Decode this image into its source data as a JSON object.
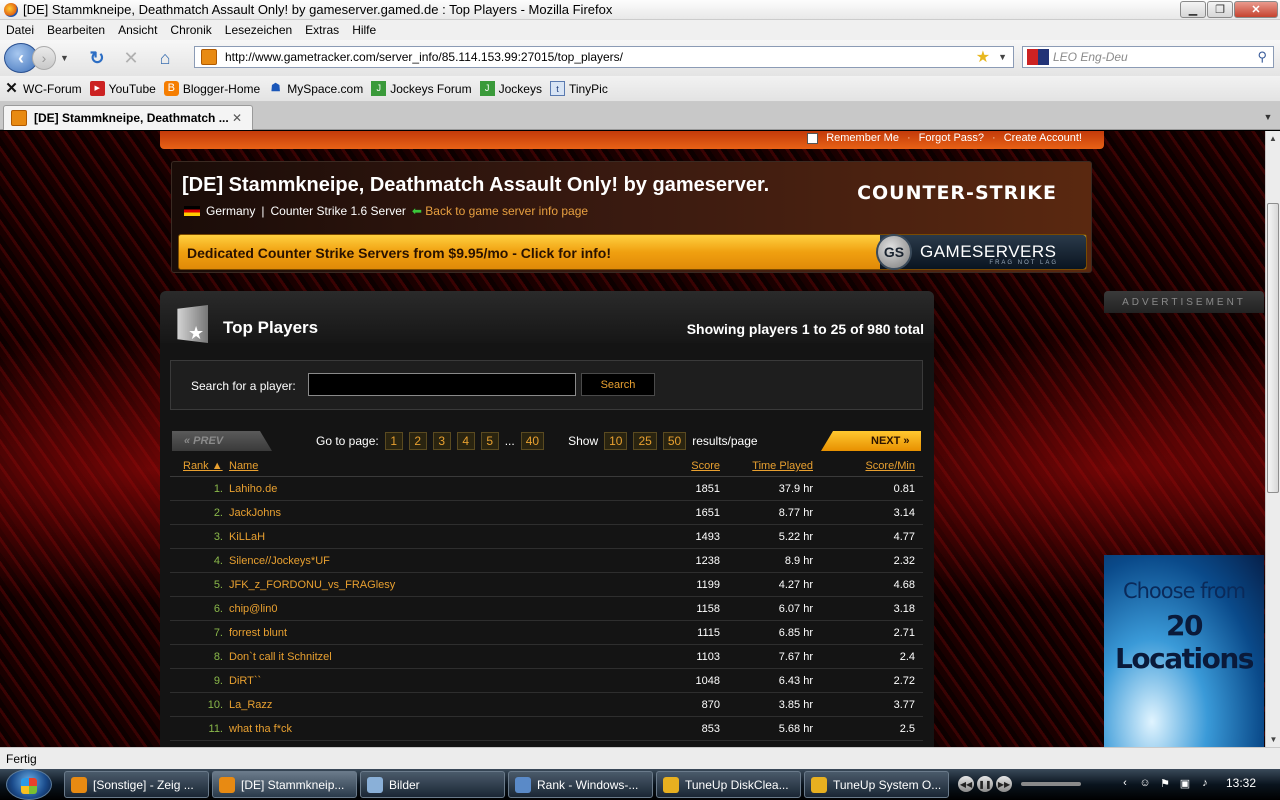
{
  "window": {
    "title": "[DE] Stammkneipe, Deathmatch Assault Only! by gameserver.gamed.de : Top Players - Mozilla Firefox",
    "min": "▁",
    "max": "❐",
    "close": "✕"
  },
  "menu": [
    "Datei",
    "Bearbeiten",
    "Ansicht",
    "Chronik",
    "Lesezeichen",
    "Extras",
    "Hilfe"
  ],
  "nav": {
    "url": "http://www.gametracker.com/server_info/85.114.153.99:27015/top_players/",
    "search_placeholder": "LEO Eng-Deu"
  },
  "bookmarks": [
    "WC-Forum",
    "YouTube",
    "Blogger-Home",
    "MySpace.com",
    "Jockeys Forum",
    "Jockeys",
    "TinyPic"
  ],
  "tab": {
    "label": "[DE] Stammkneipe, Deathmatch ..."
  },
  "site": {
    "login": {
      "remember": "Remember Me",
      "forgot": "Forgot Pass?",
      "create": "Create Account!"
    },
    "server_title": "[DE] Stammkneipe, Deathmatch Assault Only! by gameserver.",
    "country": "Germany",
    "separator": "|",
    "game": "Counter Strike 1.6 Server",
    "back_link": "Back to game server info page",
    "game_logo": "COUNTER-STRIKE",
    "banner_text": "Dedicated Counter Strike Servers from $9.95/mo - Click for info!",
    "banner_brand": "GAMESERVERS",
    "banner_brand_short": "GS",
    "banner_tagline": "FRAG NOT LAG",
    "advertisement": "ADVERTISEMENT",
    "ad_line1": "Choose from",
    "ad_line2": "20 Locations"
  },
  "top_players": {
    "title": "Top Players",
    "showing": "Showing players 1 to 25 of 980 total",
    "search_label": "Search for a player:",
    "search_value": "",
    "search_button": "Search",
    "prev": "« PREV",
    "next": "NEXT »",
    "goto_label": "Go to page:",
    "pages": [
      "1",
      "2",
      "3",
      "4",
      "5"
    ],
    "ellipsis": "...",
    "last_page": "40",
    "show_label": "Show",
    "per_page": [
      "10",
      "25",
      "50"
    ],
    "per_page_suffix": "results/page",
    "columns": {
      "rank": "Rank ▲",
      "name": "Name",
      "score": "Score",
      "time": "Time Played",
      "spm": "Score/Min"
    },
    "rows": [
      {
        "rank": "1.",
        "name": "Lahiho.de",
        "score": "1851",
        "time": "37.9 hr",
        "spm": "0.81"
      },
      {
        "rank": "2.",
        "name": "JackJohns",
        "score": "1651",
        "time": "8.77 hr",
        "spm": "3.14"
      },
      {
        "rank": "3.",
        "name": "KiLLaH",
        "score": "1493",
        "time": "5.22 hr",
        "spm": "4.77"
      },
      {
        "rank": "4.",
        "name": "Silence//Jockeys*UF",
        "score": "1238",
        "time": "8.9 hr",
        "spm": "2.32"
      },
      {
        "rank": "5.",
        "name": "JFK_z_FORDONU_vs_FRAGlesy",
        "score": "1199",
        "time": "4.27 hr",
        "spm": "4.68"
      },
      {
        "rank": "6.",
        "name": "chip@lin0",
        "score": "1158",
        "time": "6.07 hr",
        "spm": "3.18"
      },
      {
        "rank": "7.",
        "name": "forrest blunt",
        "score": "1115",
        "time": "6.85 hr",
        "spm": "2.71"
      },
      {
        "rank": "8.",
        "name": "Don`t call it Schnitzel",
        "score": "1103",
        "time": "7.67 hr",
        "spm": "2.4"
      },
      {
        "rank": "9.",
        "name": "DiRT``",
        "score": "1048",
        "time": "6.43 hr",
        "spm": "2.72"
      },
      {
        "rank": "10.",
        "name": "La_Razz",
        "score": "870",
        "time": "3.85 hr",
        "spm": "3.77"
      },
      {
        "rank": "11.",
        "name": "what tha f*ck",
        "score": "853",
        "time": "5.68 hr",
        "spm": "2.5"
      }
    ]
  },
  "status": "Fertig",
  "taskbar": {
    "items": [
      {
        "label": "[Sonstige] - Zeig ...",
        "icon_color": "#e88a12"
      },
      {
        "label": "[DE] Stammkneip...",
        "icon_color": "#e88a12"
      },
      {
        "label": "Bilder",
        "icon_color": "#8ab0d8"
      },
      {
        "label": "Rank - Windows-...",
        "icon_color": "#5a8ac8"
      },
      {
        "label": "TuneUp DiskClea...",
        "icon_color": "#e8b020"
      },
      {
        "label": "TuneUp System O...",
        "icon_color": "#e8b020"
      }
    ],
    "clock": "13:32"
  }
}
